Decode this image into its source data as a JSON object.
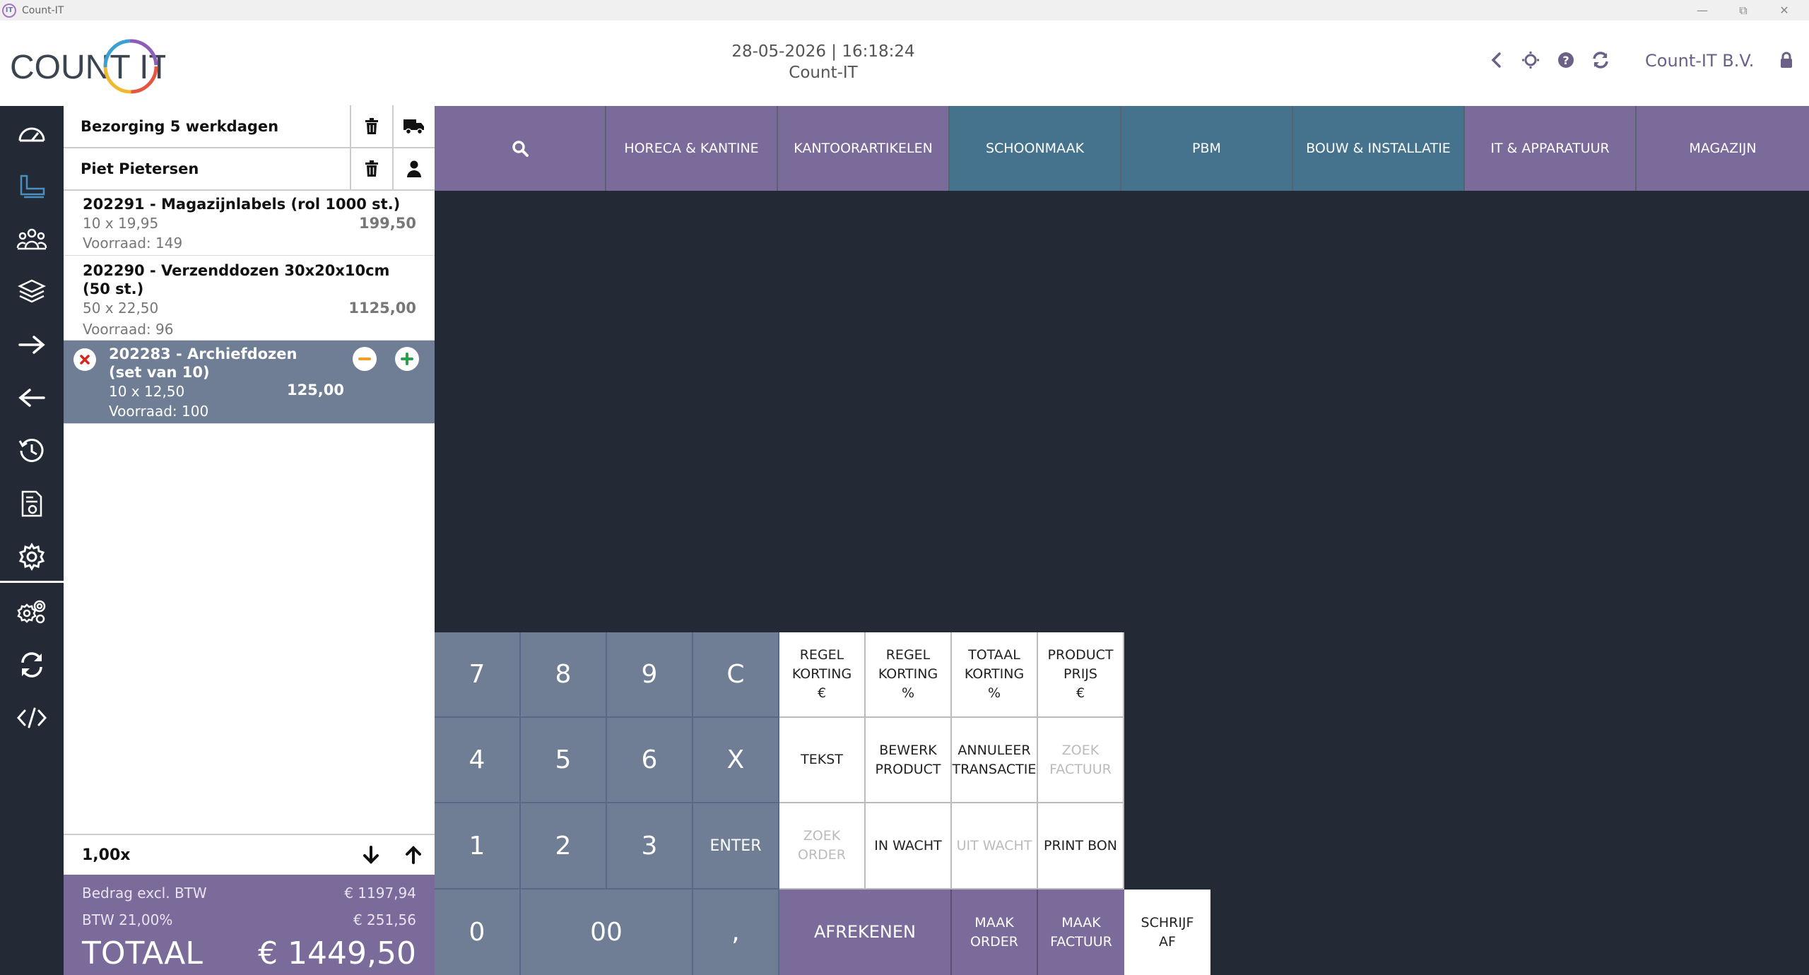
{
  "window": {
    "title": "Count-IT",
    "icon_text": "IT"
  },
  "header": {
    "logo_text": "COUNT IT",
    "datetime": "28-05-2026 | 16:18:24",
    "subtitle": "Count-IT",
    "company": "Count-IT B.V."
  },
  "cart": {
    "delivery_label": "Bezorging 5 werkdagen",
    "customer_label": "Piet Pietersen",
    "items": [
      {
        "name": "202291 - Magazijnlabels (rol 1000 st.)",
        "qty_price": "10 x 19,95",
        "total": "199,50",
        "stock": "Voorraad: 149"
      },
      {
        "name": "202290 - Verzenddozen 30x20x10cm (50 st.)",
        "qty_price": "50 x 22,50",
        "total": "1125,00",
        "stock": "Voorraad: 96"
      },
      {
        "name": "202283 - Archiefdozen (set van 10)",
        "qty_price": "10 x 12,50",
        "total": "125,00",
        "stock": "Voorraad: 100"
      }
    ],
    "quantity": "1,00x",
    "totals": {
      "excl_label": "Bedrag excl. BTW",
      "excl_value": "€ 1197,94",
      "vat_label": "BTW 21,00%",
      "vat_value": "€ 251,56",
      "total_label": "TOTAAL",
      "total_value": "€ 1449,50"
    }
  },
  "categories": [
    {
      "label": "HORECA & KANTINE",
      "color": "#7a6b9a"
    },
    {
      "label": "KANTOORARTIKELEN",
      "color": "#7a6b9a"
    },
    {
      "label": "SCHOONMAAK",
      "color": "#45738e"
    },
    {
      "label": "PBM",
      "color": "#45738e"
    },
    {
      "label": "BOUW & INSTALLATIE",
      "color": "#45738e"
    },
    {
      "label": "IT & APPARATUUR",
      "color": "#7a6b9a"
    },
    {
      "label": "MAGAZIJN",
      "color": "#7a6b9a"
    }
  ],
  "keypad": {
    "k7": "7",
    "k8": "8",
    "k9": "9",
    "clear": "C",
    "k4": "4",
    "k5": "5",
    "k6": "6",
    "times": "X",
    "k1": "1",
    "k2": "2",
    "k3": "3",
    "enter": "ENTER",
    "k0": "0",
    "k00": "00",
    "comma": ","
  },
  "functions": {
    "regel_korting_eur": [
      "REGEL",
      "KORTING",
      "€"
    ],
    "regel_korting_pct": [
      "REGEL",
      "KORTING",
      "%"
    ],
    "totaal_korting_pct": [
      "TOTAAL",
      "KORTING",
      "%"
    ],
    "product_prijs": [
      "PRODUCT",
      "PRIJS",
      "€"
    ],
    "tekst": "TEKST",
    "bewerk_product": [
      "BEWERK",
      "PRODUCT"
    ],
    "annuleer_transactie": [
      "ANNULEER",
      "TRANSACTIE"
    ],
    "zoek_factuur": [
      "ZOEK",
      "FACTUUR"
    ],
    "zoek_order": [
      "ZOEK",
      "ORDER"
    ],
    "in_wacht": "IN WACHT",
    "uit_wacht": "UIT WACHT",
    "print_bon": "PRINT BON",
    "afrekenen": "AFREKENEN",
    "maak_order": [
      "MAAK",
      "ORDER"
    ],
    "maak_factuur": [
      "MAAK",
      "FACTUUR"
    ],
    "schrijf_af": [
      "SCHRIJF",
      "AF"
    ]
  }
}
